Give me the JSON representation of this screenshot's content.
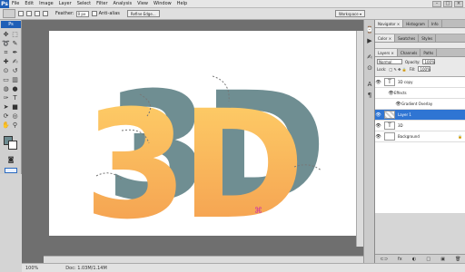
{
  "menubar": {
    "logo": "Ps",
    "items": [
      "File",
      "Edit",
      "Image",
      "Layer",
      "Select",
      "Filter",
      "Analysis",
      "View",
      "Window",
      "Help"
    ],
    "controls": [
      "–",
      "□",
      "×"
    ]
  },
  "options": {
    "feather_label": "Feather:",
    "feather_value": "0 px",
    "anti_alias_label": "Anti-alias",
    "refine_edge_label": "Refine Edge...",
    "workspace_label": "Workspace ▾"
  },
  "toolbox": {
    "badge": "Ps"
  },
  "canvas": {
    "text": "3D",
    "colors": {
      "gradient_top": "#ffd36a",
      "gradient_bottom": "#f39a4d",
      "shadow": "#6f8e92"
    }
  },
  "status": {
    "zoom": "100%",
    "doc": "Doc: 1.03M/1.14M"
  },
  "dock": {
    "top_tabs": [
      "Navigator ×",
      "Histogram",
      "Info"
    ],
    "color_tabs": [
      "Color ×",
      "Swatches",
      "Styles"
    ],
    "layers_tabs": [
      "Layers ×",
      "Channels",
      "Paths"
    ],
    "blend_mode": "Normal",
    "opacity_label": "Opacity:",
    "opacity_value": "100%",
    "lock_label": "Lock:",
    "fill_label": "Fill:",
    "fill_value": "100%",
    "layers": [
      {
        "name": "3D copy",
        "type": "text"
      },
      {
        "name": "Effects",
        "type": "sub"
      },
      {
        "name": "Gradient Overlay",
        "type": "sub2"
      },
      {
        "name": "Layer 1",
        "type": "layer",
        "selected": true
      },
      {
        "name": "3D",
        "type": "text"
      },
      {
        "name": "Background",
        "type": "bg"
      }
    ],
    "footer_icons": [
      "⊂⊃",
      "fx",
      "◐",
      "□",
      "▣",
      "🗑"
    ]
  }
}
